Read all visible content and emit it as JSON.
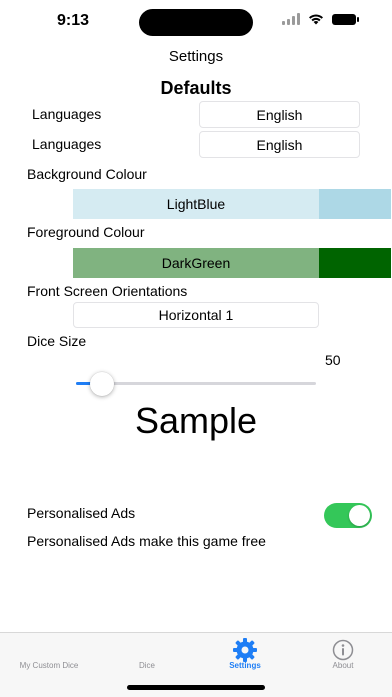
{
  "status": {
    "time": "9:13"
  },
  "nav": {
    "title": "Settings"
  },
  "section": {
    "title": "Defaults"
  },
  "languages": [
    {
      "label": "Languages",
      "value": "English"
    },
    {
      "label": "Languages",
      "value": "English"
    }
  ],
  "background": {
    "label": "Background Colour",
    "value": "LightBlue",
    "fill": "#d5ebf2",
    "tail": "#add8e6"
  },
  "foreground": {
    "label": "Foreground Colour",
    "value": "DarkGreen",
    "fill": "#80b380",
    "tail": "#006400"
  },
  "orientation": {
    "label": "Front Screen Orientations",
    "value": "Horizontal 1"
  },
  "dice": {
    "label": "Dice Size",
    "value": "50"
  },
  "sample": {
    "text": "Sample"
  },
  "ads": {
    "label": "Personalised Ads",
    "note": "Personalised Ads make this game free",
    "enabled": true
  },
  "tabs": [
    {
      "label": "My Custom Dice",
      "icon": "custom-dice-icon"
    },
    {
      "label": "Dice",
      "icon": "dice-icon"
    },
    {
      "label": "Settings",
      "icon": "gear-icon",
      "active": true
    },
    {
      "label": "About",
      "icon": "info-icon"
    }
  ],
  "colors": {
    "accent": "#1f7ef5",
    "toggle_on": "#34c759"
  }
}
